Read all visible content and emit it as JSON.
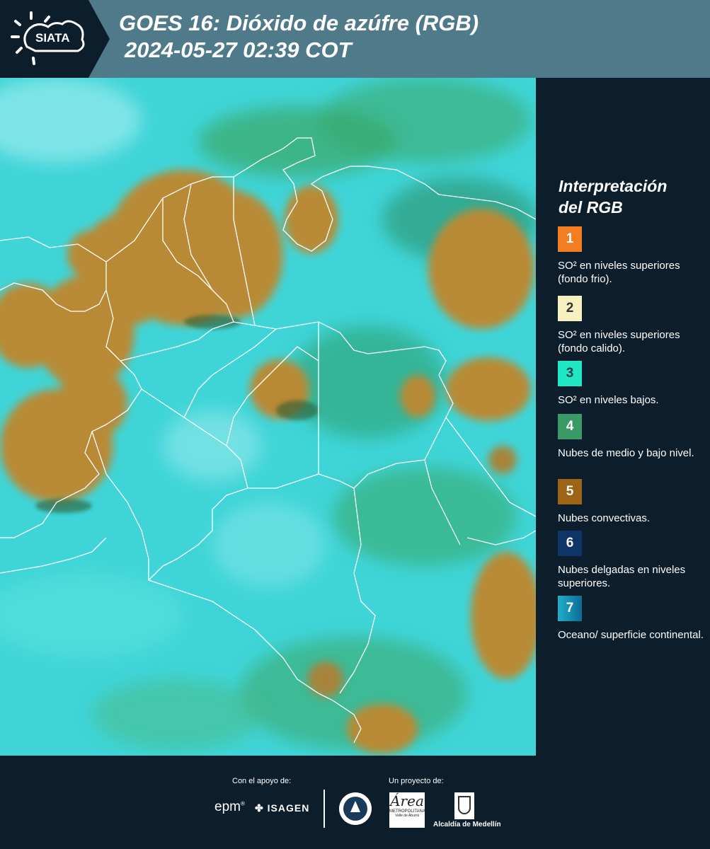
{
  "header": {
    "logo_text": "SIATA",
    "title": "GOES 16: Dióxido de azúfre (RGB)",
    "timestamp": "2024-05-27 02:39 COT"
  },
  "legend": {
    "title_line1": "Interpretación",
    "title_line2": "del RGB",
    "items": [
      {
        "number": "1",
        "color": "#f47d20",
        "text": "SO² en niveles superiores (fondo frio)."
      },
      {
        "number": "2",
        "color": "#f7f0c0",
        "text": "SO² en niveles superiores (fondo calido)."
      },
      {
        "number": "3",
        "color": "#21e6c4",
        "text": "SO² en niveles bajos."
      },
      {
        "number": "4",
        "color": "#3a9a66",
        "text": "Nubes de medio y bajo nivel."
      },
      {
        "number": "5",
        "color": "#9c6414",
        "text": "Nubes convectivas."
      },
      {
        "number": "6",
        "color": "#0f3466",
        "text": "Nubes delgadas en niveles superiores."
      },
      {
        "number": "7",
        "color": "#1590b4",
        "text": "Oceano/ superficie continental."
      }
    ]
  },
  "footer": {
    "support_label": "Con el apoyo de:",
    "project_label": "Un proyecto de:",
    "sponsor_epm": "epm",
    "sponsor_isagen": "ISAGEN",
    "area_metropolitana": "Área",
    "area_sub": "METROPOLITANA",
    "area_sub2": "Valle de Aburrá",
    "alcaldia": "Alcaldía de Medellín"
  }
}
